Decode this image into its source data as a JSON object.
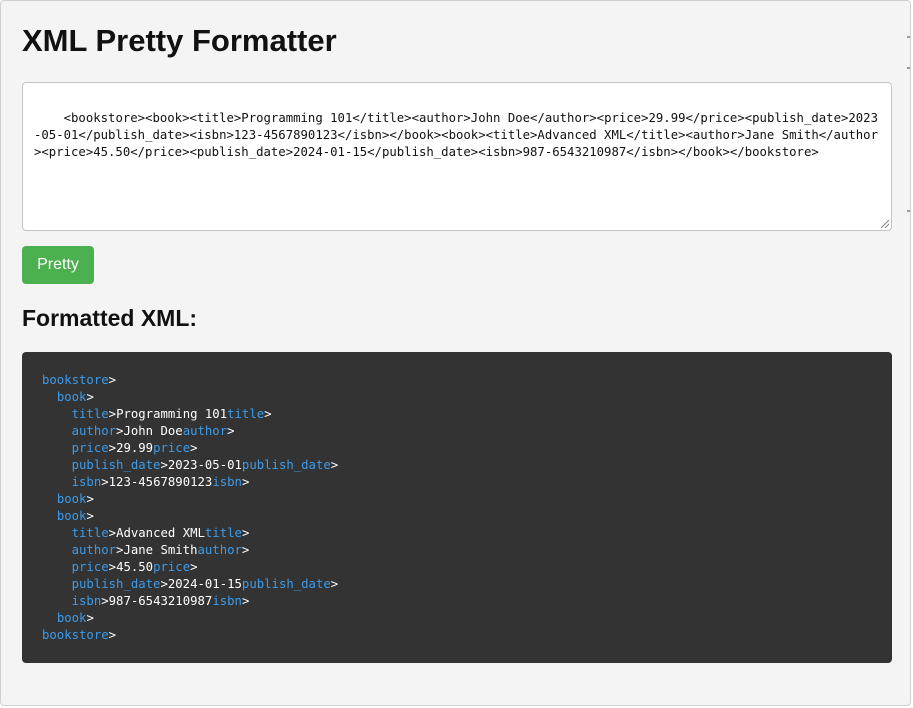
{
  "app": {
    "title": "XML Pretty Formatter"
  },
  "input": {
    "value": "<bookstore><book><title>Programming 101</title><author>John Doe</author><price>29.99</price><publish_date>2023-05-01</publish_date><isbn>123-4567890123</isbn></book><book><title>Advanced XML</title><author>Jane Smith</author><price>45.50</price><publish_date>2024-01-15</publish_date><isbn>987-6543210987</isbn></book></bookstore>"
  },
  "toolbar": {
    "pretty_label": "Pretty"
  },
  "output": {
    "heading": "Formatted XML:",
    "lines": [
      {
        "indent": 0,
        "open": "bookstore",
        "text": "",
        "close": ""
      },
      {
        "indent": 1,
        "open": "book",
        "text": "",
        "close": ""
      },
      {
        "indent": 2,
        "open": "title",
        "text": "Programming 101",
        "close": "title"
      },
      {
        "indent": 2,
        "open": "author",
        "text": "John Doe",
        "close": "author"
      },
      {
        "indent": 2,
        "open": "price",
        "text": "29.99",
        "close": "price"
      },
      {
        "indent": 2,
        "open": "publish_date",
        "text": "2023-05-01",
        "close": "publish_date"
      },
      {
        "indent": 2,
        "open": "isbn",
        "text": "123-4567890123",
        "close": "isbn"
      },
      {
        "indent": 1,
        "open": "book",
        "text": "",
        "close": ""
      },
      {
        "indent": 1,
        "open": "book",
        "text": "",
        "close": ""
      },
      {
        "indent": 2,
        "open": "title",
        "text": "Advanced XML",
        "close": "title"
      },
      {
        "indent": 2,
        "open": "author",
        "text": "Jane Smith",
        "close": "author"
      },
      {
        "indent": 2,
        "open": "price",
        "text": "45.50",
        "close": "price"
      },
      {
        "indent": 2,
        "open": "publish_date",
        "text": "2024-01-15",
        "close": "publish_date"
      },
      {
        "indent": 2,
        "open": "isbn",
        "text": "987-6543210987",
        "close": "isbn"
      },
      {
        "indent": 1,
        "open": "book",
        "text": "",
        "close": ""
      },
      {
        "indent": 0,
        "open": "bookstore",
        "text": "",
        "close": ""
      }
    ]
  },
  "colors": {
    "button": "#4caf50",
    "output_background": "#333333",
    "tag": "#3d9be9"
  }
}
